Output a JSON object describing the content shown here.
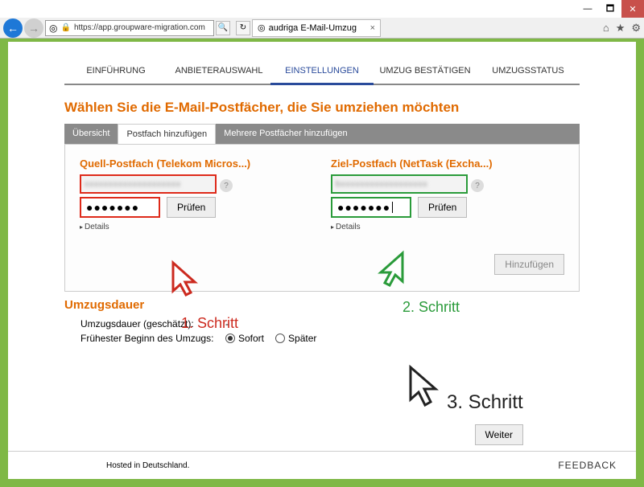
{
  "window": {
    "url": "https://app.groupware-migration.com",
    "tab_title": "audriga E-Mail-Umzug"
  },
  "nav": {
    "steps": [
      "EINFÜHRUNG",
      "ANBIETERAUSWAHL",
      "EINSTELLUNGEN",
      "UMZUG BESTÄTIGEN",
      "UMZUGSSTATUS"
    ],
    "active_index": 2
  },
  "heading": "Wählen Sie die E-Mail-Postfächer, die Sie umziehen möchten",
  "tabs": {
    "overview": "Übersicht",
    "add": "Postfach hinzufügen",
    "add_multi": "Mehrere Postfächer hinzufügen"
  },
  "source": {
    "title": "Quell-Postfach (Telekom Micros...)",
    "password": "●●●●●●●",
    "check": "Prüfen",
    "details": "Details"
  },
  "target": {
    "title": "Ziel-Postfach (NetTask (Excha...)",
    "password": "●●●●●●●",
    "check": "Prüfen",
    "details": "Details"
  },
  "add_button": "Hinzufügen",
  "duration": {
    "heading": "Umzugsdauer",
    "est_label": "Umzugsdauer (geschätzt):",
    "est_value": "-",
    "start_label": "Frühester Beginn des Umzugs:",
    "now": "Sofort",
    "later": "Später"
  },
  "next": "Weiter",
  "footer": "Hosted in Deutschland.",
  "feedback": "FEEDBACK",
  "annotations": {
    "step1": "1. Schritt",
    "step2": "2. Schritt",
    "step3": "3. Schritt"
  }
}
